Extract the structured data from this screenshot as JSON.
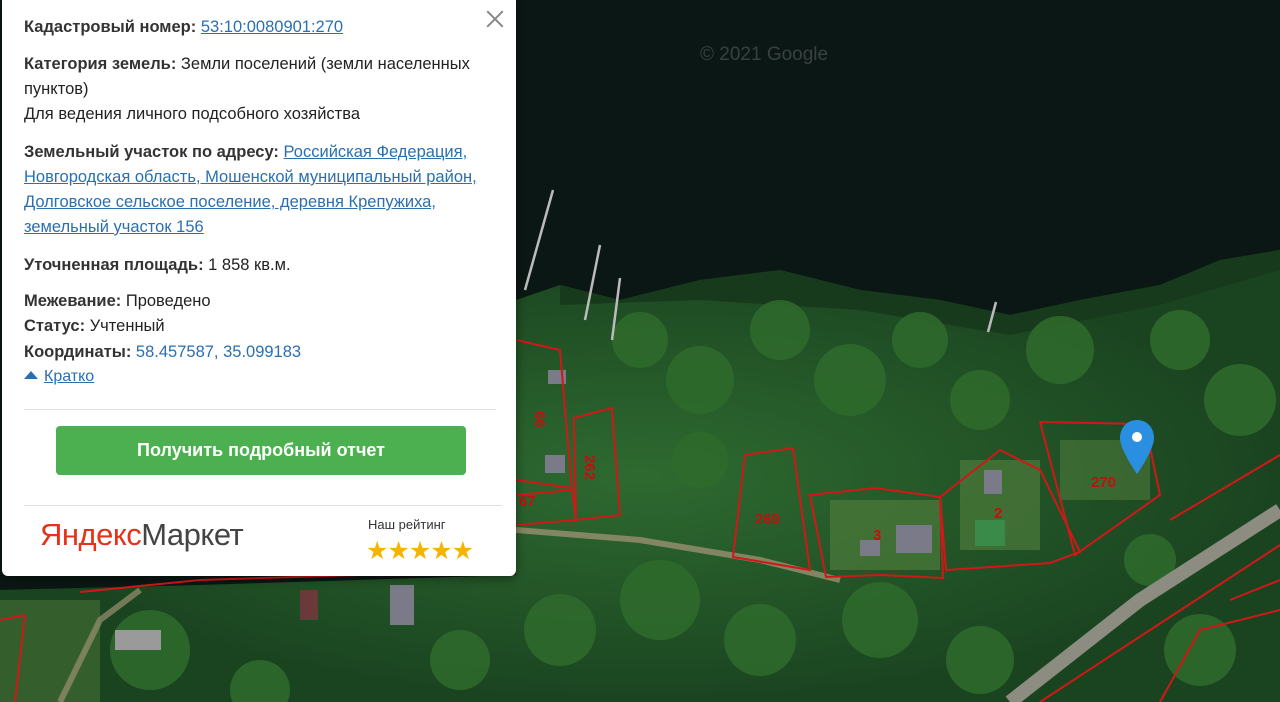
{
  "popup": {
    "cadastral_label": "Кадастровый номер:",
    "cadastral_number": "53:10:0080901:270",
    "category_label": "Категория земель:",
    "category_value": "Земли поселений (земли населенных пунктов)",
    "usage": "Для ведения личного подсобного хозяйства",
    "address_label": "Земельный участок по адресу:",
    "address_value": "Российская Федерация, Новгородская область, Мошенской муниципальный район, Долговское сельское поселение, деревня Крепужиха, земельный участок 156",
    "area_label": "Уточненная площадь:",
    "area_value": "1 858 кв.м.",
    "survey_label": "Межевание:",
    "survey_value": "Проведено",
    "status_label": "Статус:",
    "status_value": "Учтенный",
    "coords_label": "Координаты:",
    "coords_value": "58.457587, 35.099183",
    "collapse_link": "Кратко",
    "report_button": "Получить подробный отчет",
    "market_brand_y": "Яндекс",
    "market_brand_rest": "Маркет",
    "rating_label": "Наш рейтинг",
    "rating_stars": "★★★★★",
    "close_icon": "close-icon",
    "collapse_icon": "triangle-up-icon"
  },
  "map": {
    "watermark": "© 2021 Google",
    "pin_icon": "location-pin-icon",
    "parcel_labels": [
      "66",
      "262",
      "67",
      "269",
      "3",
      "2",
      "270"
    ],
    "colors": {
      "water": "#0a1512",
      "forest": "#1e4a24",
      "parcel_border": "#d01818",
      "pin": "#2a8fe0"
    }
  }
}
